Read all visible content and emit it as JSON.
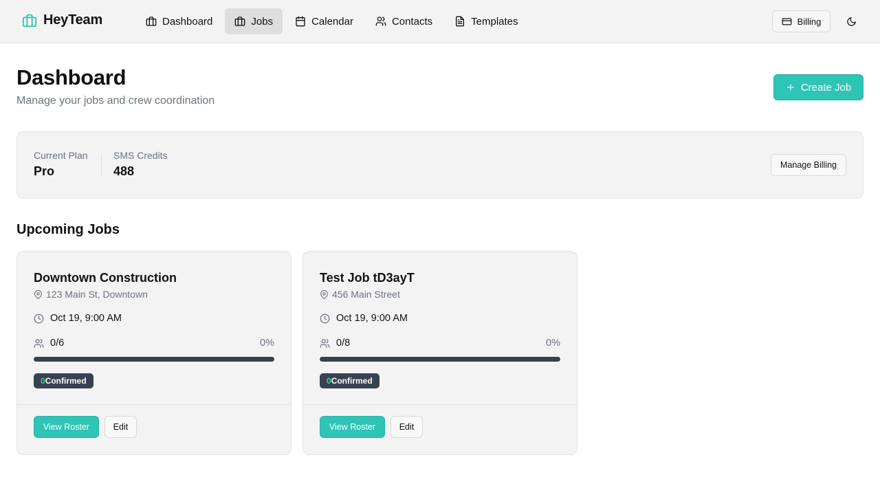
{
  "app": {
    "brand_name": "HeyTeam",
    "brand_icon": "briefcase-icon",
    "accent_color": "#2ec4b6"
  },
  "nav": {
    "items": [
      {
        "label": "Dashboard",
        "icon": "briefcase-icon",
        "active": false
      },
      {
        "label": "Jobs",
        "icon": "briefcase-icon",
        "active": true
      },
      {
        "label": "Calendar",
        "icon": "calendar-icon",
        "active": false
      },
      {
        "label": "Contacts",
        "icon": "users-icon",
        "active": false
      },
      {
        "label": "Templates",
        "icon": "file-text-icon",
        "active": false
      }
    ],
    "billing_label": "Billing",
    "billing_icon": "credit-card-icon",
    "theme_icon": "moon-icon"
  },
  "header": {
    "title": "Dashboard",
    "subtitle": "Manage your jobs and crew coordination",
    "create_label": "Create Job"
  },
  "plan": {
    "plan_label": "Current Plan",
    "plan_value": "Pro",
    "credits_label": "SMS Credits",
    "credits_value": "488",
    "manage_label": "Manage Billing"
  },
  "upcoming": {
    "title": "Upcoming Jobs",
    "jobs": [
      {
        "title": "Downtown Construction",
        "address": "123 Main St, Downtown",
        "time": "Oct 19, 9:00 AM",
        "crew": "0/6",
        "percent": "0%",
        "progress": 0,
        "confirmed_count": "0",
        "confirmed_label": "Confirmed",
        "view_label": "View Roster",
        "edit_label": "Edit"
      },
      {
        "title": "Test Job tD3ayT",
        "address": "456 Main Street",
        "time": "Oct 19, 9:00 AM",
        "crew": "0/8",
        "percent": "0%",
        "progress": 0,
        "confirmed_count": "0",
        "confirmed_label": "Confirmed",
        "view_label": "View Roster",
        "edit_label": "Edit"
      }
    ]
  }
}
